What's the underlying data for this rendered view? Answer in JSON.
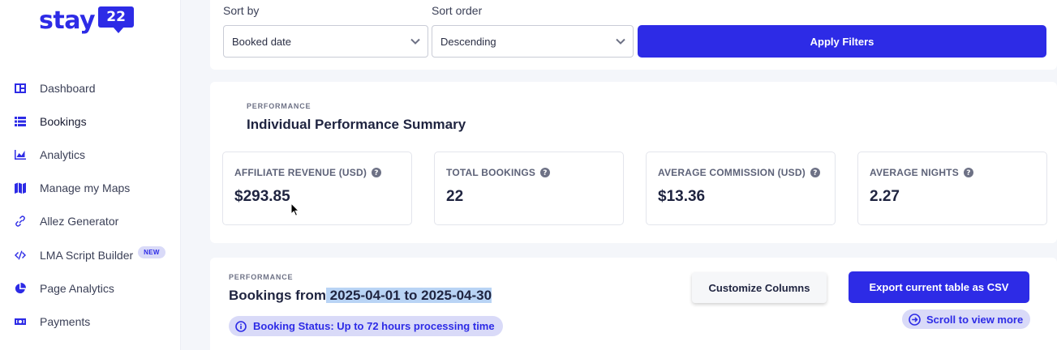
{
  "brand": {
    "word": "stay",
    "badge": "22",
    "color": "#2d2be6"
  },
  "sidebar": {
    "items": [
      {
        "label": "Dashboard",
        "icon": "dashboard-icon"
      },
      {
        "label": "Bookings",
        "icon": "list-icon"
      },
      {
        "label": "Analytics",
        "icon": "chart-icon"
      },
      {
        "label": "Manage my Maps",
        "icon": "map-icon"
      },
      {
        "label": "Allez Generator",
        "icon": "link-icon"
      },
      {
        "label": "LMA Script Builder",
        "icon": "code-icon",
        "badge": "NEW"
      },
      {
        "label": "Page Analytics",
        "icon": "pie-icon"
      },
      {
        "label": "Payments",
        "icon": "money-icon"
      }
    ]
  },
  "filters": {
    "sort_by_label": "Sort by",
    "sort_by_value": "Booked date",
    "sort_order_label": "Sort order",
    "sort_order_value": "Descending",
    "apply_label": "Apply Filters"
  },
  "summary": {
    "eyebrow": "PERFORMANCE",
    "title": "Individual Performance Summary",
    "metrics": [
      {
        "label": "AFFILIATE REVENUE (USD)",
        "value": "$293.85"
      },
      {
        "label": "TOTAL BOOKINGS",
        "value": "22"
      },
      {
        "label": "AVERAGE COMMISSION (USD)",
        "value": "$13.36"
      },
      {
        "label": "AVERAGE NIGHTS",
        "value": "2.27"
      }
    ]
  },
  "bookings": {
    "eyebrow": "PERFORMANCE",
    "title_prefix": "Bookings from",
    "title_range": " 2025-04-01 to 2025-04-30",
    "status_text": "Booking Status: Up to 72 hours processing time",
    "customize_label": "Customize Columns",
    "export_label": "Export current table as CSV",
    "scroll_label": "Scroll to view more"
  }
}
